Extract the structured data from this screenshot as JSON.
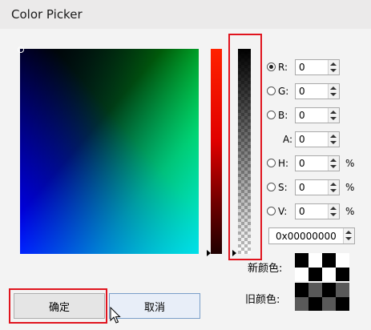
{
  "window": {
    "title": "Color Picker"
  },
  "channels": [
    {
      "label": "R:",
      "value": "0",
      "selected": true,
      "has_radio": true,
      "unit": ""
    },
    {
      "label": "G:",
      "value": "0",
      "selected": false,
      "has_radio": true,
      "unit": ""
    },
    {
      "label": "B:",
      "value": "0",
      "selected": false,
      "has_radio": true,
      "unit": ""
    },
    {
      "label": "A:",
      "value": "0",
      "selected": false,
      "has_radio": false,
      "unit": ""
    },
    {
      "label": "H:",
      "value": "0",
      "selected": false,
      "has_radio": true,
      "unit": "%"
    },
    {
      "label": "S:",
      "value": "0",
      "selected": false,
      "has_radio": true,
      "unit": "%"
    },
    {
      "label": "V:",
      "value": "0",
      "selected": false,
      "has_radio": true,
      "unit": "%"
    }
  ],
  "hex": {
    "value": "0x00000000"
  },
  "swatches": {
    "new_label": "新颜色:",
    "old_label": "旧颜色:",
    "new_color": "#000000",
    "old_color": "#000000"
  },
  "buttons": {
    "ok_label": "确定",
    "cancel_label": "取消"
  },
  "colors": {
    "highlight": "#e0141e",
    "title_bg": "#ebeaea",
    "cancel_border": "#7a9ec9"
  },
  "icons": {
    "cursor": "arrow-cursor-icon"
  }
}
